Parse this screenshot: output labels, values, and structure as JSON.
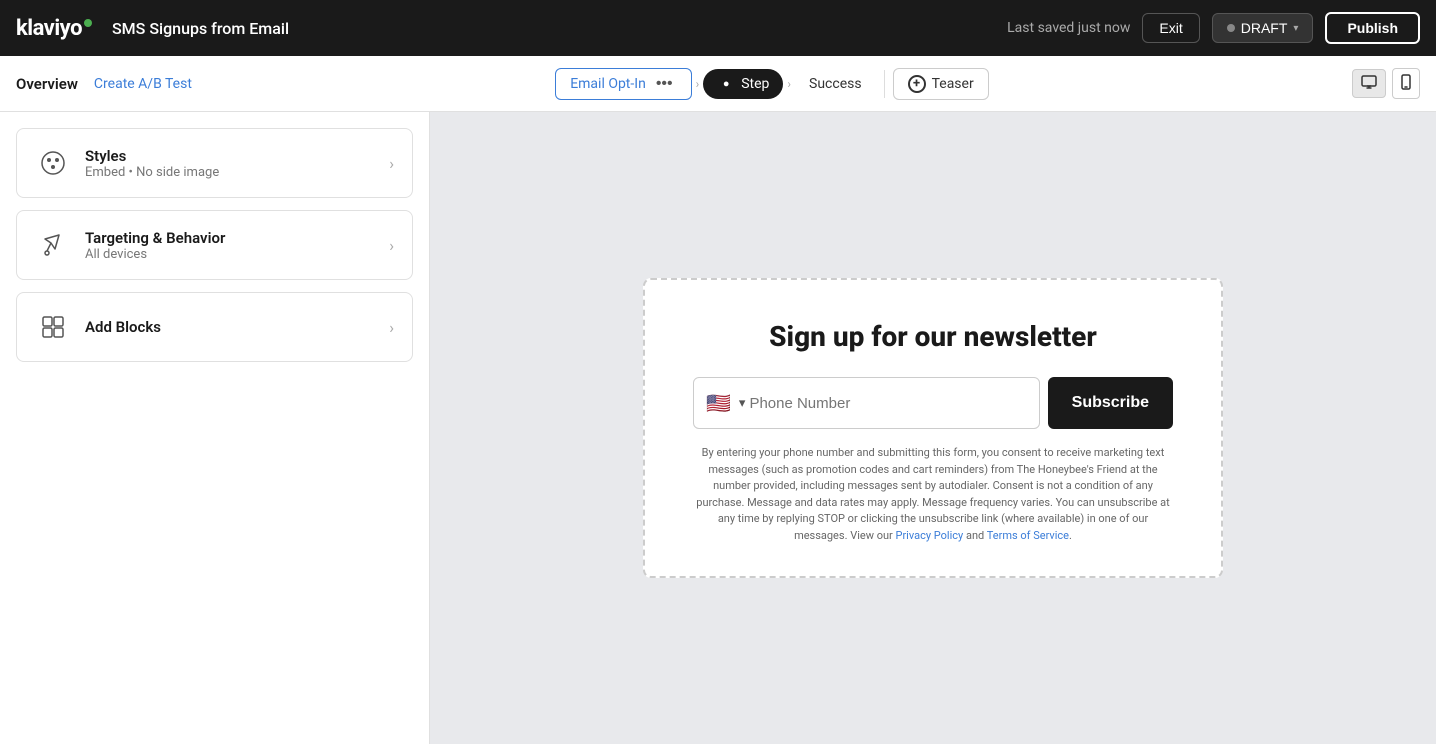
{
  "app": {
    "logo": "klaviyo",
    "page_title": "SMS Signups from Email",
    "last_saved": "Last saved just now",
    "exit_label": "Exit",
    "draft_label": "DRAFT",
    "publish_label": "Publish"
  },
  "second_nav": {
    "overview_label": "Overview",
    "create_ab_label": "Create A/B Test",
    "tabs": [
      {
        "label": "Email Opt-In",
        "type": "outline"
      },
      {
        "label": "Step",
        "type": "filled"
      },
      {
        "label": "Success",
        "type": "plain"
      },
      {
        "label": "Teaser",
        "type": "teaser"
      }
    ]
  },
  "sidebar": {
    "cards": [
      {
        "title": "Styles",
        "subtitle": "Embed • No side image",
        "icon": "palette-icon"
      },
      {
        "title": "Targeting & Behavior",
        "subtitle": "All devices",
        "icon": "targeting-icon"
      },
      {
        "title": "Add Blocks",
        "subtitle": "",
        "icon": "blocks-icon"
      }
    ]
  },
  "preview": {
    "form_title": "Sign up for our newsletter",
    "phone_placeholder": "Phone Number",
    "subscribe_label": "Subscribe",
    "disclaimer_text": "By entering your phone number and submitting this form, you consent to receive marketing text messages (such as promotion codes and cart reminders) from The Honeybee's Friend at the number provided, including messages sent by autodialer. Consent is not a condition of any purchase. Message and data rates may apply. Message frequency varies. You can unsubscribe at any time by replying STOP or clicking the unsubscribe link (where available) in one of our messages. View our",
    "privacy_label": "Privacy Policy",
    "and_text": "and",
    "terms_label": "Terms of Service",
    "period": "."
  }
}
